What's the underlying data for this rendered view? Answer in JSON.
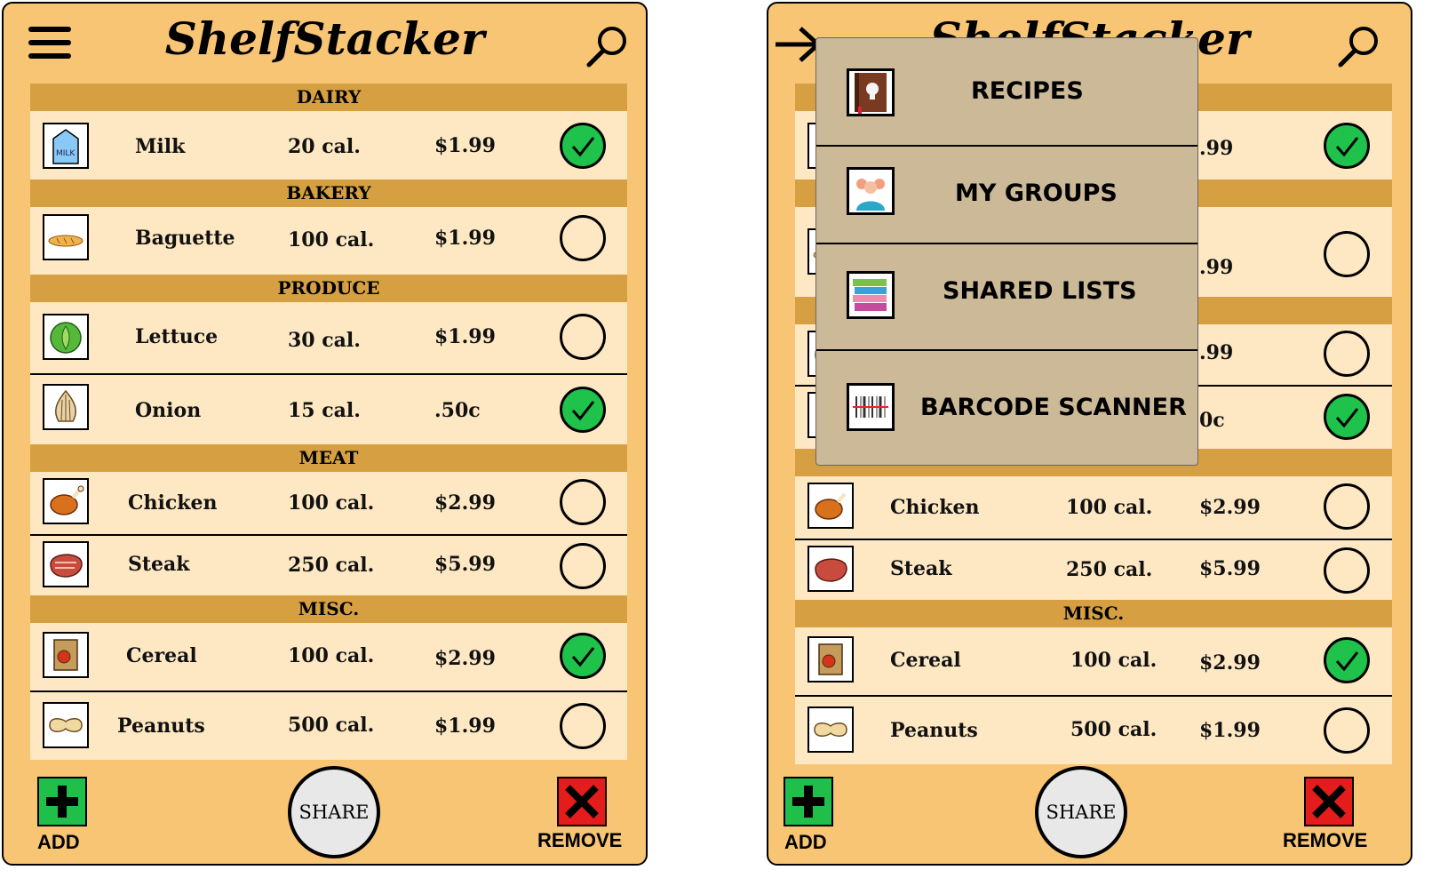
{
  "app_title": "ShelfStacker",
  "categories": {
    "dairy": "DAIRY",
    "bakery": "BAKERY",
    "produce": "PRODUCE",
    "meat": "MEAT",
    "misc": "MISC."
  },
  "items": [
    {
      "name": "Milk",
      "cal": "20 cal.",
      "price": "$1.99",
      "checked": true,
      "icon": "milk-carton-icon"
    },
    {
      "name": "Baguette",
      "cal": "100 cal.",
      "price": "$1.99",
      "checked": false,
      "icon": "baguette-icon"
    },
    {
      "name": "Lettuce",
      "cal": "30 cal.",
      "price": "$1.99",
      "checked": false,
      "icon": "lettuce-icon"
    },
    {
      "name": "Onion",
      "cal": "15 cal.",
      "price": ".50c",
      "checked": true,
      "icon": "onion-icon"
    },
    {
      "name": "Chicken",
      "cal": "100 cal.",
      "price": "$2.99",
      "checked": false,
      "icon": "chicken-icon"
    },
    {
      "name": "Steak",
      "cal": "250 cal.",
      "price": "$5.99",
      "checked": false,
      "icon": "steak-icon"
    },
    {
      "name": "Cereal",
      "cal": "100 cal.",
      "price": "$2.99",
      "checked": true,
      "icon": "cereal-box-icon"
    },
    {
      "name": "Peanuts",
      "cal": "500 cal.",
      "price": "$1.99",
      "checked": false,
      "icon": "peanut-icon"
    }
  ],
  "right_partial": {
    "milk_price": ".99",
    "baguette_price": ".99",
    "lettuce_price": ".99",
    "onion_price": "0c"
  },
  "actions": {
    "add": "ADD",
    "share": "SHARE",
    "remove": "REMOVE"
  },
  "menu": [
    {
      "label": "RECIPES",
      "icon": "recipe-book-icon"
    },
    {
      "label": "MY GROUPS",
      "icon": "group-people-icon"
    },
    {
      "label": "SHARED LISTS",
      "icon": "stacked-books-icon"
    },
    {
      "label": "BARCODE SCANNER",
      "icon": "barcode-scanner-icon"
    }
  ],
  "colors": {
    "phone_bg": "#f8c574",
    "category_bar": "#d6a042",
    "row_bg": "#fee8c3",
    "check_on": "#1fc24a",
    "add_green": "#1fbf4a",
    "remove_red": "#e51c1c",
    "menu_bg": "#ccb998"
  }
}
